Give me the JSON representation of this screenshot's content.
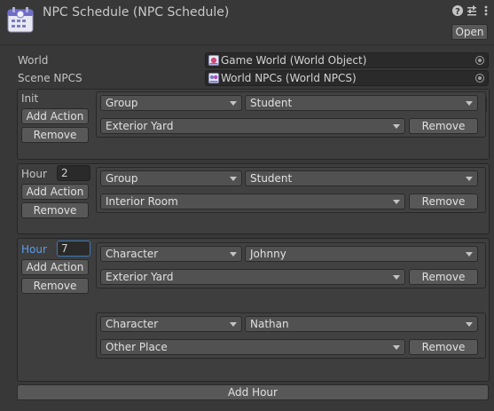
{
  "window": {
    "title": "NPC Schedule (NPC Schedule)",
    "icon": "npc-schedule-asset-icon",
    "header_icons": [
      "help-icon",
      "settings-sliders-icon",
      "kebab-menu-icon"
    ],
    "open_label": "Open"
  },
  "fields": {
    "world": {
      "label": "World",
      "value": "Game World (World Object)",
      "icon": "world-object-icon"
    },
    "scene_npcs": {
      "label": "Scene NPCS",
      "value": "World NPCs (World NPCS)",
      "icon": "world-npcs-icon"
    }
  },
  "sections": [
    {
      "label": "Init",
      "has_hour": false,
      "add_action_label": "Add Action",
      "remove_label": "Remove",
      "actions": [
        {
          "type": "Group",
          "target": "Student",
          "location": "Exterior Yard",
          "remove_label": "Remove"
        }
      ]
    },
    {
      "label": "Hour",
      "has_hour": true,
      "hour_value": "2",
      "add_action_label": "Add Action",
      "remove_label": "Remove",
      "actions": [
        {
          "type": "Group",
          "target": "Student",
          "location": "Interior Room",
          "remove_label": "Remove"
        }
      ]
    },
    {
      "label": "Hour",
      "has_hour": true,
      "hour_value": "7",
      "focused": true,
      "add_action_label": "Add Action",
      "remove_label": "Remove",
      "actions": [
        {
          "type": "Character",
          "target": "Johnny",
          "location": "Exterior Yard",
          "remove_label": "Remove"
        },
        {
          "type": "Character",
          "target": "Nathan",
          "location": "Other Place",
          "remove_label": "Remove"
        }
      ]
    }
  ],
  "add_hour_label": "Add Hour",
  "colors": {
    "background": "#383838",
    "focus_blue": "#5c9ce6",
    "button": "#585858",
    "field": "#2a2a2a"
  }
}
